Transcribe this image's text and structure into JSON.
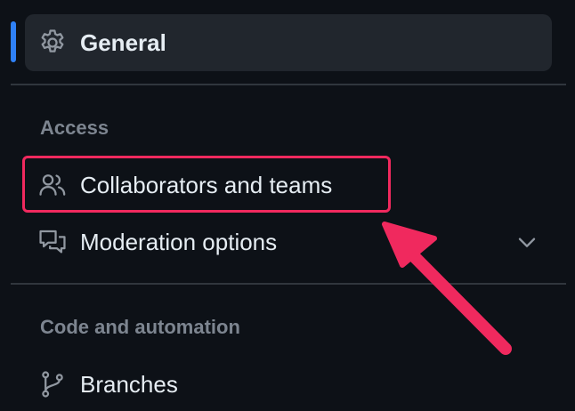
{
  "nav": {
    "general": {
      "label": "General",
      "icon": "gear-icon",
      "active": true
    },
    "access_heading": "Access",
    "collaborators": {
      "label": "Collaborators and teams",
      "icon": "people-icon",
      "highlighted": true
    },
    "moderation": {
      "label": "Moderation options",
      "icon": "comment-discussion-icon",
      "expand_icon": "chevron-down-icon"
    },
    "code_heading": "Code and automation",
    "branches": {
      "label": "Branches",
      "icon": "git-branch-icon"
    }
  },
  "colors": {
    "background": "#0d1117",
    "active_item_bg": "#21262d",
    "active_indicator": "#2f81f7",
    "text": "#e6edf3",
    "muted_text": "#7d8590",
    "divider": "#30363d",
    "annotation": "#f0295e"
  }
}
